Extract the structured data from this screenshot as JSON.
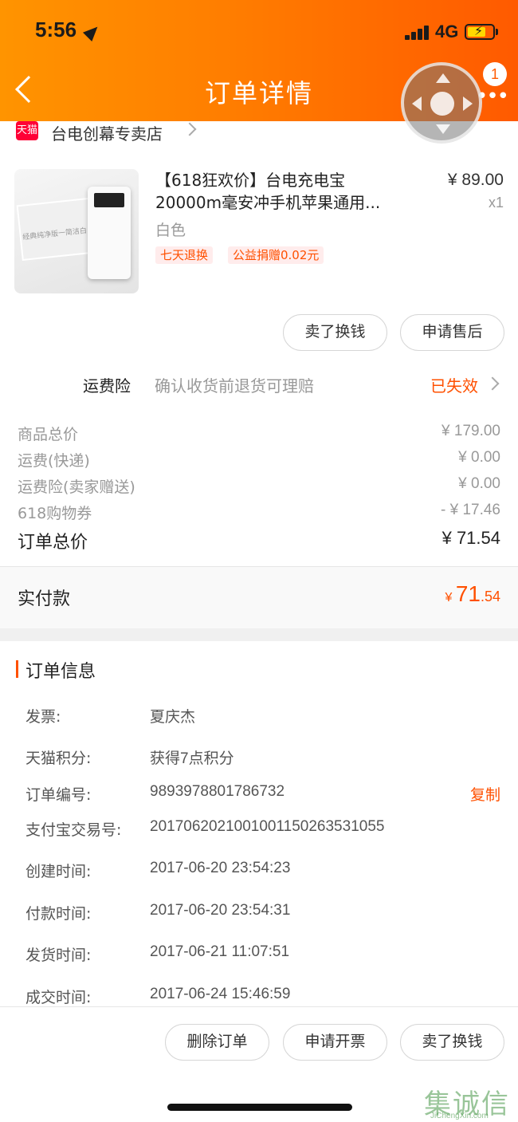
{
  "status_bar": {
    "time": "5:56",
    "network": "4G"
  },
  "header": {
    "title": "订单详情",
    "badge_count": "1"
  },
  "store": {
    "badge": "天猫",
    "name": "台电创幕专卖店"
  },
  "product": {
    "image_text": "经典纯净版一简洁白",
    "title_line1": "【618狂欢价】台电充电宝",
    "title_line2": "20000m毫安冲手机苹果通用...",
    "price": "¥ 89.00",
    "quantity": "x1",
    "sku": "白色",
    "tags": [
      "七天退换",
      "公益捐赠0.02元"
    ]
  },
  "item_actions": {
    "sell": "卖了换钱",
    "after_sale": "申请售后"
  },
  "insurance": {
    "label": "运费险",
    "desc": "确认收货前退货可理赔",
    "status": "已失效"
  },
  "prices": [
    {
      "label": "商品总价",
      "value": "¥ 179.00"
    },
    {
      "label": "运费(快递)",
      "value": "¥ 0.00"
    },
    {
      "label": "运费险(卖家赠送)",
      "value": "¥ 0.00"
    },
    {
      "label": "618购物券",
      "value": "- ¥ 17.46"
    }
  ],
  "total": {
    "label": "订单总价",
    "value": "¥ 71.54"
  },
  "payment": {
    "label": "实付款",
    "currency": "¥",
    "integer": "71",
    "decimal": ".54"
  },
  "order_info": {
    "title": "订单信息",
    "copy_label": "复制",
    "rows": [
      {
        "key": "发票:",
        "value": "夏庆杰"
      },
      {
        "key": "天猫积分:",
        "value": "获得7点积分"
      },
      {
        "key": "订单编号:",
        "value": "9893978801786732"
      },
      {
        "key": "支付宝交易号:",
        "value": "2017062021001001150263531055"
      },
      {
        "key": "创建时间:",
        "value": "2017-06-20 23:54:23"
      },
      {
        "key": "付款时间:",
        "value": "2017-06-20 23:54:31"
      },
      {
        "key": "发货时间:",
        "value": "2017-06-21 11:07:51"
      },
      {
        "key": "成交时间:",
        "value": "2017-06-24 15:46:59"
      }
    ]
  },
  "bottom_actions": {
    "delete": "删除订单",
    "invoice": "申请开票",
    "sell": "卖了换钱"
  },
  "watermark": {
    "main": "集诚信",
    "sub": "JiChengXin.com"
  },
  "colors": {
    "accent": "#ff5000",
    "header_start": "#ff9400",
    "header_end": "#ff5a00"
  }
}
